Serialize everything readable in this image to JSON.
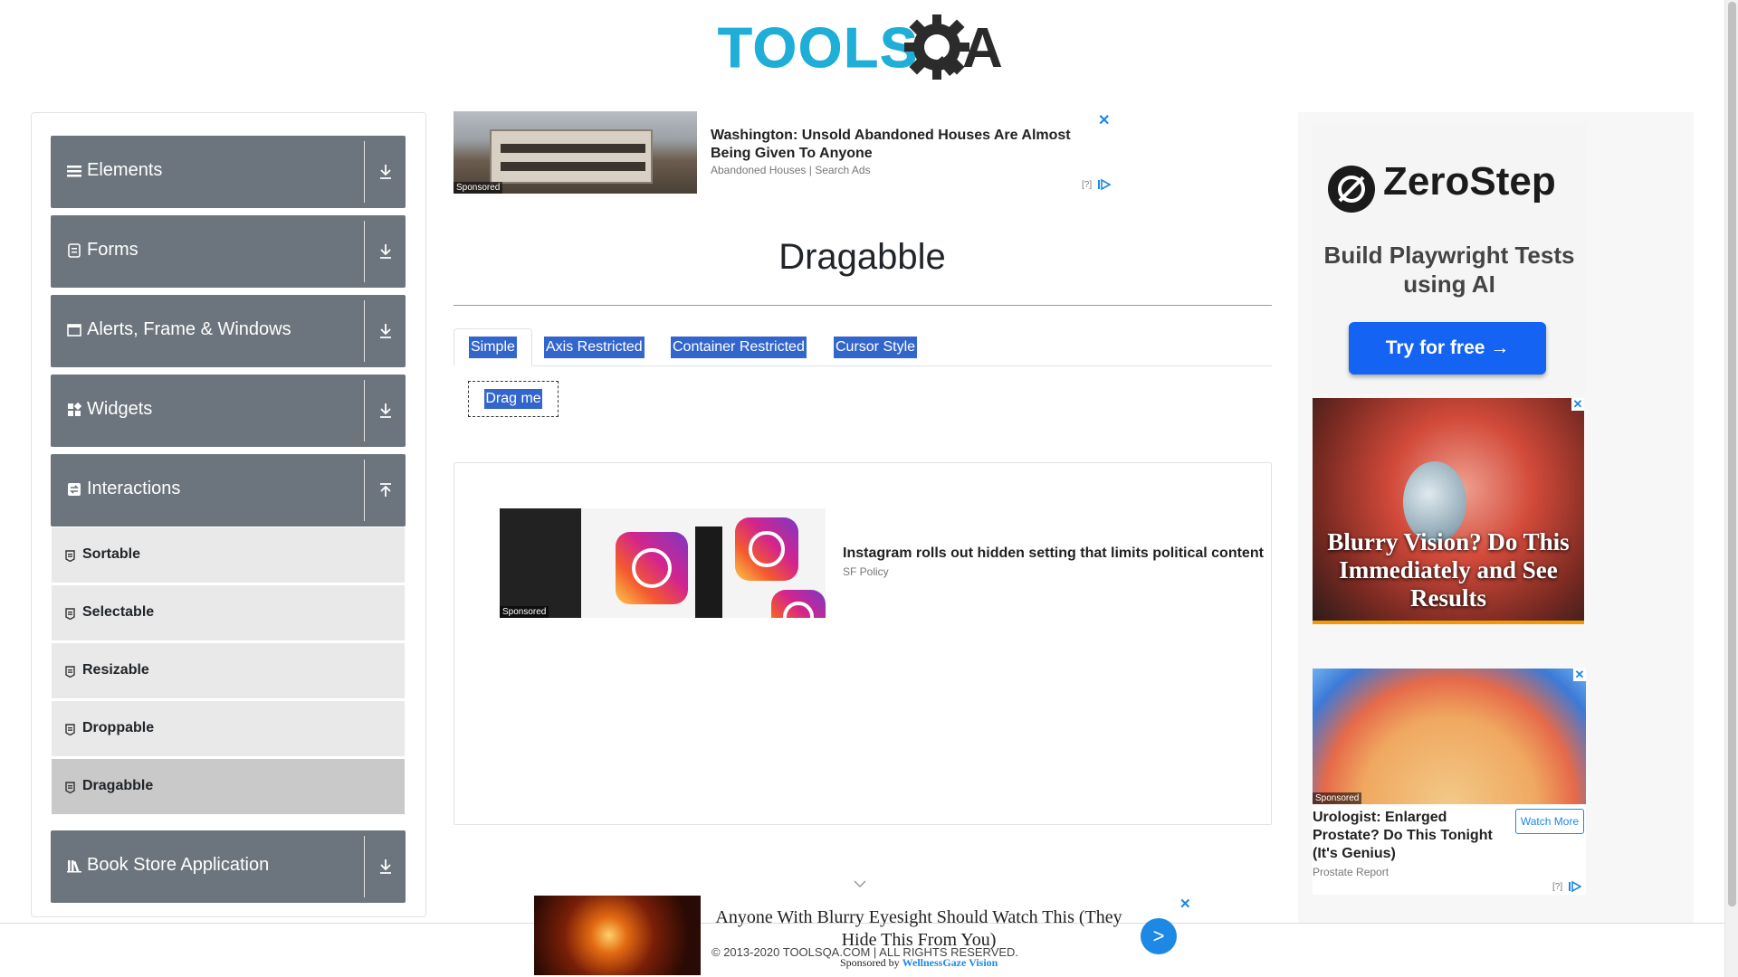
{
  "header": {
    "logo_text": "TOOLS",
    "logo_tail": "A"
  },
  "nav": {
    "groups": [
      {
        "label": "Elements",
        "icon": "menu-icon"
      },
      {
        "label": "Forms",
        "icon": "form-icon"
      },
      {
        "label": "Alerts, Frame & Windows",
        "icon": "window-icon"
      },
      {
        "label": "Widgets",
        "icon": "widgets-icon"
      },
      {
        "label": "Interactions",
        "icon": "interactions-icon",
        "expanded": true
      },
      {
        "label": "Book Store Application",
        "icon": "book-icon"
      }
    ],
    "interactions_items": [
      {
        "label": "Sortable"
      },
      {
        "label": "Selectable"
      },
      {
        "label": "Resizable"
      },
      {
        "label": "Droppable"
      },
      {
        "label": "Dragabble",
        "active": true
      }
    ]
  },
  "top_ad": {
    "title": "Washington: Unsold Abandoned Houses Are Almost Being Given To Anyone",
    "source": "Abandoned Houses | Search Ads",
    "sponsored": "Sponsored",
    "close": "✕",
    "help": "[?]"
  },
  "main": {
    "title": "Dragabble",
    "tabs": [
      {
        "label": "Simple",
        "active": true
      },
      {
        "label": "Axis Restricted"
      },
      {
        "label": "Container Restricted"
      },
      {
        "label": "Cursor Style"
      }
    ],
    "drag_box_label": "Drag me"
  },
  "mid_ad": {
    "title": "Instagram rolls out hidden setting that limits political content",
    "source": "SF Policy",
    "sponsored": "Sponsored"
  },
  "right_ads": {
    "zerostep": {
      "brand": "ZeroStep",
      "tagline": "Build Playwright Tests using AI",
      "cta": "Try for free →"
    },
    "eye": {
      "text": "Blurry Vision? Do This Immediately and See Results",
      "close": "✕"
    },
    "prostate": {
      "title": "Urologist: Enlarged Prostate? Do This Tonight (It's Genius)",
      "source": "Prostate Report",
      "button": "Watch More",
      "sponsored": "Sponsored",
      "close": "✕",
      "help": "[?]"
    }
  },
  "bottom_ad": {
    "text": "Anyone With Blurry Eyesight Should Watch This (They Hide This From You)",
    "go": ">",
    "close": "✕",
    "sponsored_by_prefix": "Sponsored by",
    "sponsored_by_name": "WellnessGaze Vision"
  },
  "footer": {
    "copyright": "© 2013-2020 TOOLSQA.COM | ALL RIGHTS RESERVED."
  },
  "colors": {
    "nav_group": "#6c757d",
    "sub_item": "#e9e9e9",
    "sub_active": "#c9c9c9",
    "tab_highlight": "#3366cc",
    "brand": "#1faed8"
  }
}
